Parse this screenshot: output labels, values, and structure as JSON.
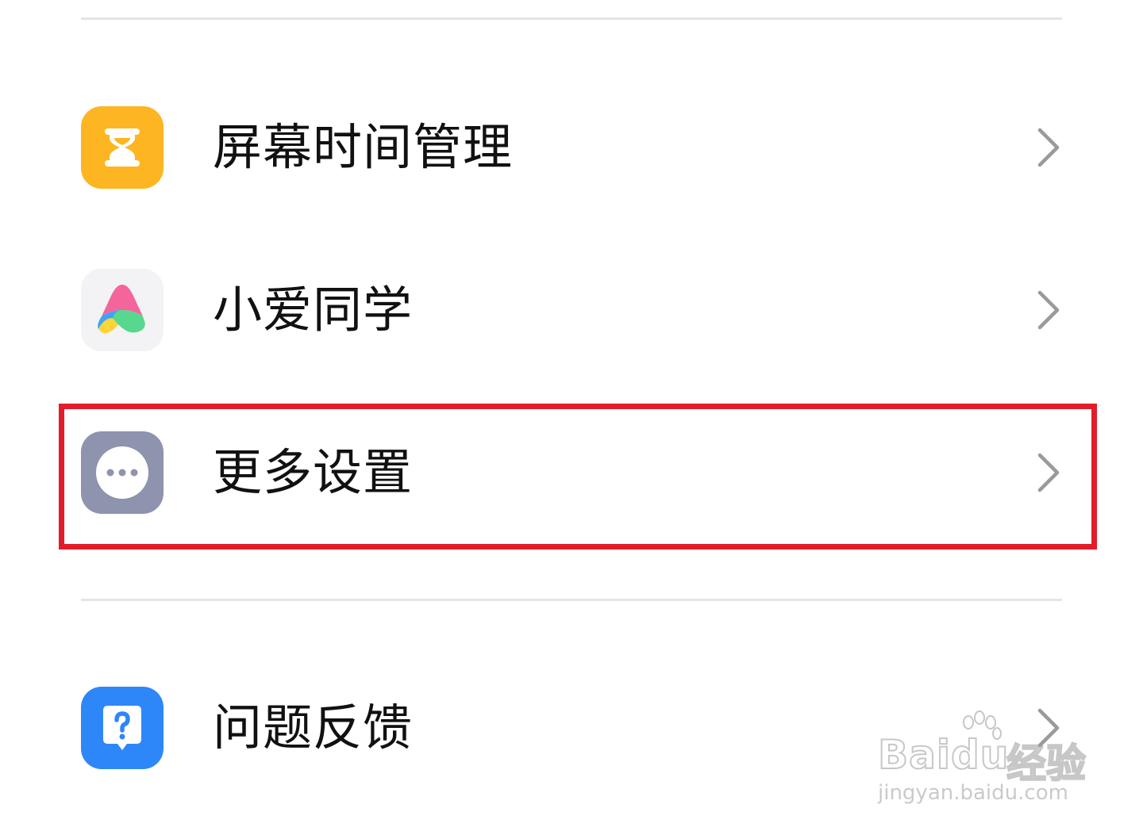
{
  "settings_list": {
    "items": [
      {
        "key": "screen-time",
        "label": "屏幕时间管理",
        "icon": "hourglass-icon",
        "icon_color": "#FDB521"
      },
      {
        "key": "xiaoai",
        "label": "小爱同学",
        "icon": "xiaoai-assistant-icon",
        "icon_color": "#F3F3F5"
      },
      {
        "key": "more-settings",
        "label": "更多设置",
        "icon": "more-dots-icon",
        "icon_color": "#8E93AE"
      },
      {
        "key": "feedback",
        "label": "问题反馈",
        "icon": "feedback-question-icon",
        "icon_color": "#2D87F9"
      }
    ],
    "chevron_icon": "chevron-right-icon"
  },
  "highlight": {
    "target": "more-settings",
    "color": "#E21C2A"
  },
  "watermark": {
    "brand": "Bai",
    "brand_mid": "du",
    "brand_cn": "经验",
    "url": "jingyan.baidu.com"
  }
}
